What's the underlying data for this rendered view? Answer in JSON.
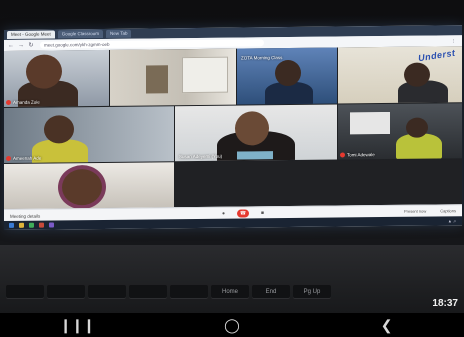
{
  "browser": {
    "tabs": [
      "Meet - Google Meet",
      "Google Classroom",
      "New Tab"
    ],
    "url": "meet.google.com/ykh-zgmm-oeb"
  },
  "participants": [
    {
      "name": "Amanda Zoie",
      "muted": true
    },
    {
      "name": "",
      "muted": false
    },
    {
      "name": "ZOTA Morning Class",
      "muted": false
    },
    {
      "name": "",
      "muted": false
    },
    {
      "name": "Ameenah Ade",
      "muted": true
    },
    {
      "name": "Susan Adeyemi (You)",
      "muted": false
    },
    {
      "name": "Tomi Adewale",
      "muted": true
    },
    {
      "name": "",
      "muted": false
    }
  ],
  "banner_text": "Underst",
  "meet_bar": {
    "details_label": "Meeting details",
    "right_items": [
      "Present now",
      "Captions"
    ]
  },
  "clock": "18:37",
  "keys": [
    "",
    "",
    "",
    "",
    "",
    "Home",
    "End",
    "Pg Up"
  ],
  "colors": {
    "end_call": "#e5392f",
    "taskbar": "#1a2433"
  }
}
